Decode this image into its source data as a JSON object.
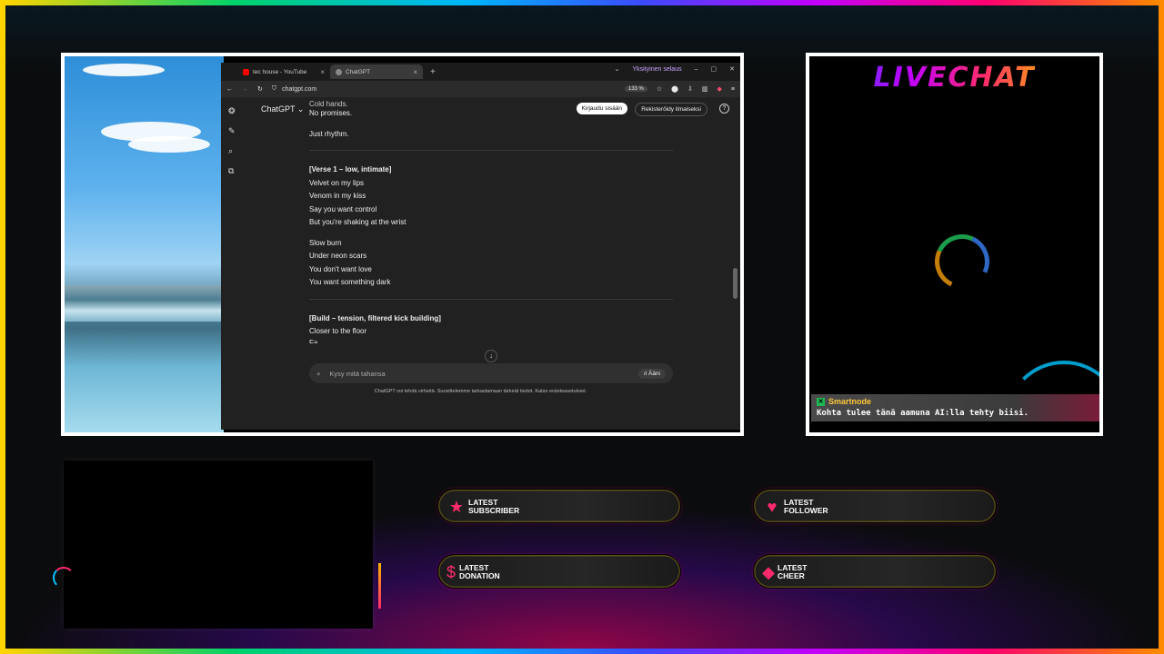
{
  "browser": {
    "tabs": [
      {
        "label": "tec house - YouTube",
        "favicon_color": "#ff0000"
      },
      {
        "label": "ChatGPT",
        "favicon_color": "#888888"
      }
    ],
    "profile_label": "Yksityinen selaus",
    "url": "chatgpt.com",
    "zoom": "133 %"
  },
  "chatgpt": {
    "model_label": "ChatGPT ⌄",
    "login_label": "Kirjaudu sisään",
    "signup_label": "Rekisteröidy ilmaiseksi",
    "help_label": "?",
    "stanzas": [
      {
        "heading": "",
        "lines": [
          "Cold hands.",
          "No promises."
        ]
      },
      {
        "heading": "",
        "lines": [
          "Just rhythm."
        ]
      },
      {
        "heading": "[Verse 1 – low, intimate]",
        "lines": [
          "Velvet on my lips",
          "Venom in my kiss",
          "Say you want control",
          "But you're shaking at the wrist"
        ]
      },
      {
        "heading": "",
        "lines": [
          "Slow burn",
          "Under neon scars",
          "You don't want love",
          "You want something dark"
        ]
      },
      {
        "heading": "[Build – tension, filtered kick building]",
        "lines": [
          "Closer to the floor",
          "Fa..."
        ]
      }
    ],
    "composer_placeholder": "Kysy mitä tahansa",
    "voice_label": "Ääni",
    "footnote": "ChatGPT voi tehdä virheitä. Suosittelemme tarkastamaan tärkeät tiedot. Katso evästeasetukset."
  },
  "livechat": {
    "title": "LIVECHAT",
    "message": {
      "user": "Smartnode",
      "text": "Kohta tulee tänä aamuna AI:lla tehty biisi."
    }
  },
  "widgets": [
    {
      "icon": "star-icon",
      "line1": "LATEST",
      "line2": "SUBSCRIBER",
      "color": "#ff2a6d"
    },
    {
      "icon": "heart-icon",
      "line1": "LATEST",
      "line2": "FOLLOWER",
      "color": "#ff2a6d"
    },
    {
      "icon": "dollar-icon",
      "line1": "LATEST",
      "line2": "DONATION",
      "color": "#ff2a6d"
    },
    {
      "icon": "diamond-icon",
      "line1": "LATEST",
      "line2": "CHEER",
      "color": "#ff2a6d"
    }
  ]
}
